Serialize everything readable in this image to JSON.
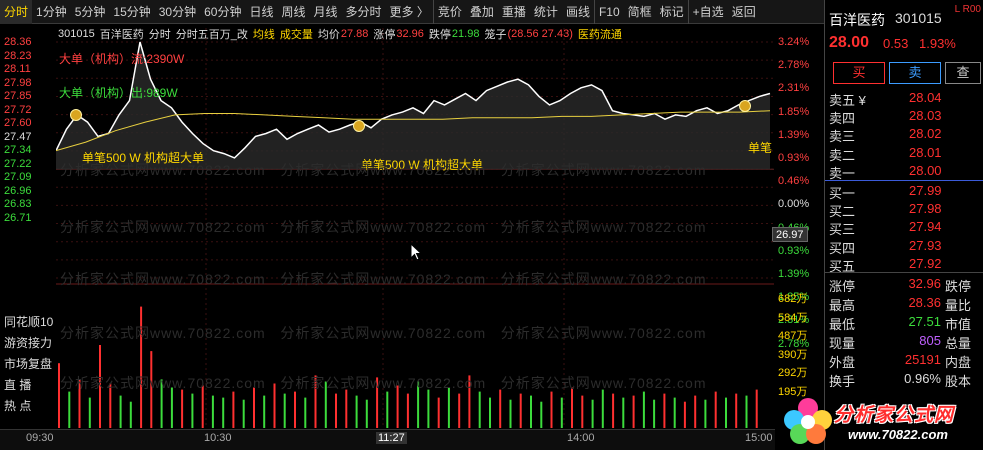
{
  "toolbar": {
    "items": [
      "分时",
      "1分钟",
      "5分钟",
      "15分钟",
      "30分钟",
      "60分钟",
      "日线",
      "周线",
      "月线",
      "多分时",
      "更多 〉",
      "竞价",
      "叠加",
      "重播",
      "统计",
      "画线",
      "F10",
      "简框",
      "标记",
      "+自选",
      "返回"
    ],
    "active": "分时"
  },
  "info": {
    "code": "301015",
    "name": "百洋医药",
    "mode": "分时",
    "indicator": "分时五百万_改",
    "avg_line_label": "均线",
    "volume_label": "成交量",
    "avg_price_label": "均价",
    "avg_price": "27.88",
    "limit_up_label": "涨停",
    "limit_up": "32.96",
    "limit_down_label": "跌停",
    "limit_down": "21.98",
    "cage_label": "笼子",
    "cage_value": "(28.56 27.43)",
    "sector": "医药流通"
  },
  "price_axis": [
    "28.36",
    "28.23",
    "28.11",
    "27.98",
    "27.85",
    "27.72",
    "27.60",
    "27.47",
    "27.34",
    "27.22",
    "27.09",
    "26.96",
    "26.83",
    "26.71"
  ],
  "pct_axis": [
    "3.24%",
    "2.78%",
    "2.31%",
    "1.85%",
    "1.39%",
    "0.93%",
    "0.46%",
    "0.00%",
    "0.46%",
    "0.93%",
    "1.39%",
    "1.85%",
    "2.31%",
    "2.78%"
  ],
  "volume_axis": [
    "682万",
    "584万",
    "487万",
    "390万",
    "292万",
    "195万"
  ],
  "cursor_price": "26.97",
  "annotations": {
    "big_order_in": "大单（机构）流:2390W",
    "big_order_out": "大单（机构）出:989W",
    "single_big_1": "单笔500 W 机构超大单",
    "single_big_2": "单笔500 W 机构超大单",
    "single_big_3": "单笔"
  },
  "watermark": "分析家公式网www.70822.com",
  "side_nav": [
    "同花顺10",
    "游资接力",
    "市场复盘",
    "直 播",
    "热 点"
  ],
  "time_axis": [
    "09:30",
    "10:30",
    "11:27",
    "14:00",
    "15:00"
  ],
  "panel": {
    "name": "百洋医药",
    "code": "301015",
    "badge": "L R00",
    "price": "28.00",
    "change": "0.53",
    "change_pct": "1.93%",
    "buy_label": "买",
    "sell_label": "卖",
    "query_label": "查",
    "asks": [
      {
        "label": "卖五 ¥",
        "price": "28.04"
      },
      {
        "label": "卖四",
        "price": "28.03"
      },
      {
        "label": "卖三",
        "price": "28.02"
      },
      {
        "label": "卖二",
        "price": "28.01"
      },
      {
        "label": "卖一",
        "price": "28.00"
      }
    ],
    "bids": [
      {
        "label": "买一",
        "price": "27.99"
      },
      {
        "label": "买二",
        "price": "27.98"
      },
      {
        "label": "买三",
        "price": "27.94"
      },
      {
        "label": "买四",
        "price": "27.93"
      },
      {
        "label": "买五",
        "price": "27.92"
      }
    ],
    "stats": [
      {
        "label": "涨停",
        "value": "32.96",
        "label2": "跌停"
      },
      {
        "label": "最高",
        "value": "28.36",
        "label2": "量比"
      },
      {
        "label": "最低",
        "value": "27.51",
        "label2": "市值"
      },
      {
        "label": "现量",
        "value": "805",
        "label2": "总量"
      },
      {
        "label": "外盘",
        "value": "25191",
        "label2": "内盘"
      },
      {
        "label": "换手",
        "value": "0.96%",
        "label2": "股本"
      }
    ]
  },
  "logo": {
    "title": "分析家公式网",
    "url": "www.70822.com"
  },
  "chart_data": {
    "type": "line",
    "x_range": [
      "09:30",
      "15:00"
    ],
    "ylim": [
      26.71,
      28.36
    ],
    "prev_close": 27.47,
    "price_series": [
      27.6,
      27.75,
      27.85,
      27.8,
      27.7,
      27.72,
      27.85,
      27.95,
      28.36,
      28.1,
      27.95,
      27.9,
      27.8,
      27.72,
      27.65,
      27.6,
      27.58,
      27.55,
      27.62,
      27.7,
      27.72,
      27.75,
      27.68,
      27.72,
      27.75,
      27.78,
      27.73,
      27.75,
      27.78,
      27.8,
      27.76,
      27.82,
      27.85,
      27.87,
      27.9,
      27.86,
      27.95,
      27.92,
      27.96,
      28.0,
      27.95,
      28.02,
      28.05,
      28.08,
      28.1,
      28.06,
      27.98,
      27.92,
      27.95,
      28.0,
      28.04,
      28.06,
      28.02,
      27.88,
      27.86,
      27.85,
      27.84,
      27.86,
      27.82,
      27.85,
      27.84,
      27.88,
      27.9,
      27.86,
      27.88,
      27.92,
      27.95,
      27.98,
      28.0
    ],
    "avg_series": [
      27.6,
      27.66,
      27.74,
      27.8,
      27.85,
      27.86,
      27.86,
      27.85,
      27.84,
      27.83,
      27.82,
      27.82,
      27.82,
      27.82,
      27.83,
      27.83,
      27.83,
      27.84,
      27.84,
      27.85,
      27.86,
      27.87,
      27.87,
      27.87,
      27.88
    ],
    "volume_series": [
      320,
      180,
      240,
      150,
      410,
      220,
      160,
      130,
      600,
      380,
      240,
      200,
      190,
      170,
      210,
      160,
      150,
      180,
      140,
      200,
      160,
      220,
      170,
      180,
      150,
      260,
      230,
      170,
      190,
      160,
      140,
      250,
      180,
      210,
      170,
      230,
      190,
      150,
      200,
      170,
      260,
      180,
      150,
      190,
      140,
      170,
      160,
      130,
      180,
      150,
      200,
      160,
      140,
      190,
      170,
      150,
      160,
      180,
      140,
      170,
      150,
      130,
      160,
      140,
      180,
      150,
      170,
      160,
      190
    ],
    "volume_colors_up": [
      true,
      false,
      true,
      false,
      true,
      true,
      false,
      false,
      true,
      true,
      false,
      false,
      true,
      false,
      true,
      false,
      false,
      true,
      false,
      true,
      false,
      true,
      false,
      true,
      false,
      true,
      false,
      true,
      true,
      false,
      false,
      true,
      false,
      true,
      true,
      false,
      false,
      true,
      false,
      true,
      true,
      false,
      false,
      true,
      false,
      true,
      false,
      false,
      true,
      false,
      true,
      true,
      false,
      false,
      true,
      false,
      true,
      false,
      false,
      true,
      false,
      true,
      true,
      false,
      true,
      false,
      true,
      false,
      true
    ]
  }
}
